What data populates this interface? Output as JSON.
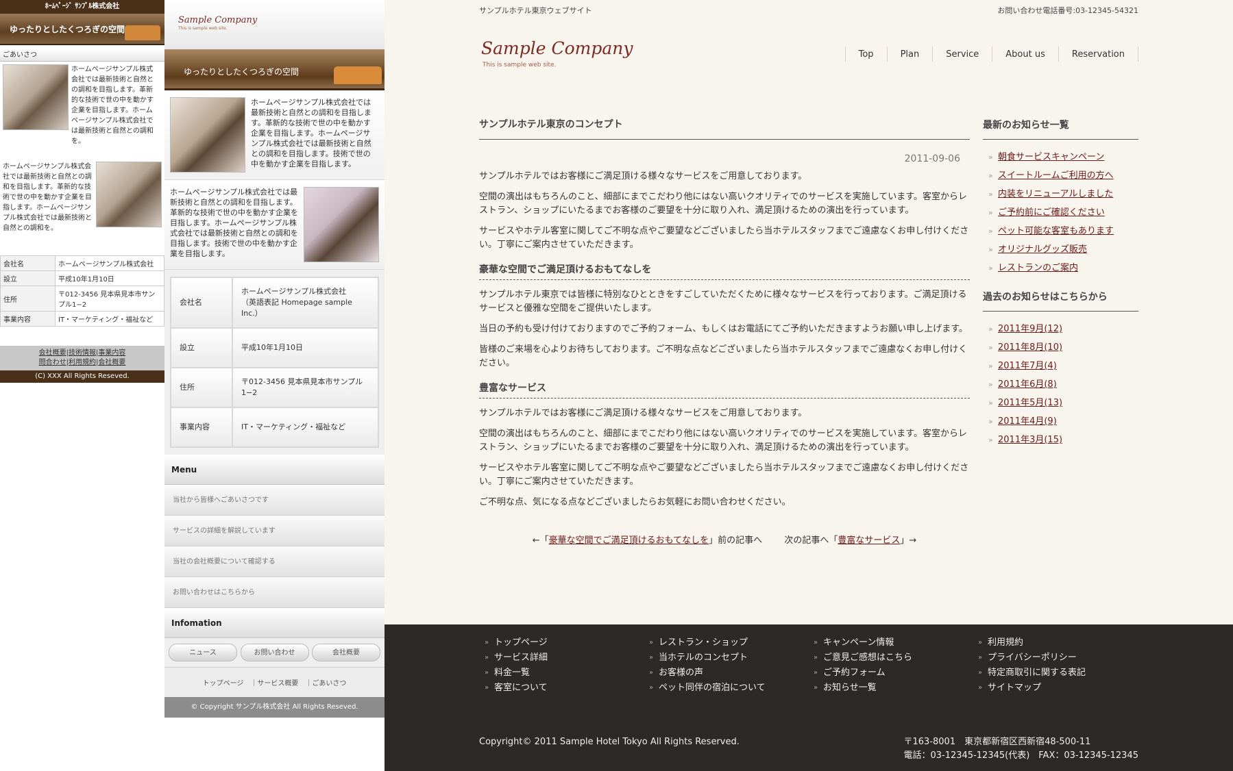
{
  "mobile": {
    "brand": "ﾎｰﾑﾍﾟｰｼﾞ ｻﾝﾌﾟﾙ株式会社",
    "hero": "ゆったりとしたくつろぎの空間",
    "section": "ごあいさつ",
    "text1": "ホームページサンプル株式会社では最新技術と自然との調和を目指します。革新的な技術で世の中を動かす企業を目指します。ホームページサンプル株式会社では最新技術と自然との調和を。",
    "text2": "ホームページサンプル株式会社では最新技術と自然との調和を目指します。革新的な技術で世の中を動かす企業を目指します。ホームページサンプル株式会社では最新技術と自然との調和を。",
    "table": [
      {
        "k": "会社名",
        "v": "ホームページサンプル株式会社"
      },
      {
        "k": "設立",
        "v": "平成10年1月10日"
      },
      {
        "k": "住所",
        "v": "〒012-3456 見本県見本市サンプル1−2"
      },
      {
        "k": "事業内容",
        "v": "IT・マーケティング・福祉など"
      }
    ],
    "links": [
      "会社概要",
      "技術情報",
      "事業内容",
      "問合わせ",
      "利用規約",
      "会社概要"
    ],
    "copyright": "(C) XXX All Rights Reseved."
  },
  "tablet": {
    "logo": "Sample Company",
    "logo_sub": "This is sample web site.",
    "hero": "ゆったりとしたくつろぎの空間",
    "text1": "ホームページサンプル株式会社では最新技術と自然との調和を目指します。革新的な技術で世の中を動かす企業を目指します。ホームページサンプル株式会社では最新技術と自然との調和を目指します。技術で世の中を動かす企業を目指します。",
    "text2": "ホームページサンプル株式会社では最新技術と自然との調和を目指します。革新的な技術で世の中を動かす企業を目指します。ホームページサンプル株式会社では最新技術と自然との調和を目指します。技術で世の中を動かす企業を目指します。",
    "table": [
      {
        "k": "会社名",
        "v": "ホームページサンプル株式会社",
        "v2": "（英語表記 Homepage sample Inc.）"
      },
      {
        "k": "設立",
        "v": "平成10年1月10日",
        "v2": ""
      },
      {
        "k": "住所",
        "v": "〒012-3456 見本県見本市サンプル1−2",
        "v2": ""
      },
      {
        "k": "事業内容",
        "v": "IT・マーケティング・福祉など",
        "v2": ""
      }
    ],
    "menu_title": "Menu",
    "menu": [
      "当社から皆様へごあいさつです",
      "サービスの詳細を解説しています",
      "当社の会社概要について確認する",
      "お問い合わせはこちらから"
    ],
    "info_title": "Infomation",
    "buttons": [
      "ニュース",
      "お問い合わせ",
      "会社概要"
    ],
    "footer_links": "トップページ　｜サービス概要　｜ごあいさつ",
    "copyright": "© Copyright サンプル株式会社 All Rights Reseved."
  },
  "desktop": {
    "site_title": "サンプルホテル東京ウェブサイト",
    "phone": "お問い合わせ電話番号:03-12345-54321",
    "logo": "Sample Company",
    "logo_sub": "This is sample web site.",
    "nav": [
      "Top",
      "Plan",
      "Service",
      "About us",
      "Reservation"
    ],
    "main": {
      "title": "サンプルホテル東京のコンセプト",
      "date": "2011-09-06",
      "p1": "サンプルホテルではお客様にご満足頂ける様々なサービスをご用意しております。",
      "p2": "空間の演出はもちろんのこと、細部にまでこだわり他にはない高いクオリティでのサービスを実施しています。客室からレストラン、ショップにいたるまでお客様のご要望を十分に取り入れ、満足頂けるための演出を行っています。",
      "p3": "サービスやホテル客室に関してご不明な点やご要望などございましたら当ホテルスタッフまでご遠慮なくお申し付けください。丁寧にご案内させていただきます。",
      "h1": "豪華な空間でご満足頂けるおもてなしを",
      "p4": "サンプルホテル東京では皆様に特別なひとときをすごしていただくために様々なサービスを行っております。ご満足頂けるサービスと優雅な空間をご提供いたします。",
      "p5": "当日の予約も受け付けておりますのでご予約フォーム、もしくはお電話にてご予約いただきますようお願い申し上げます。",
      "p6": "皆様のご来場を心よりお待ちしております。ご不明な点などございましたら当ホテルスタッフまでご遠慮なくお申し付けください。",
      "h2": "豊富なサービス",
      "p7": "サンプルホテルではお客様にご満足頂ける様々なサービスをご用意しております。",
      "p8": "空間の演出はもちろんのこと、細部にまでこだわり他にはない高いクオリティでのサービスを実施しています。客室からレストラン、ショップにいたるまでお客様のご要望を十分に取り入れ、満足頂けるための演出を行っています。",
      "p9": "サービスやホテル客室に関してご不明な点やご要望などございましたら当ホテルスタッフまでご遠慮なくお申し付けください。丁寧にご案内させていただきます。",
      "p10": "ご不明な点、気になる点などございましたらお気軽にお問い合わせください。",
      "prev_pre": "←「",
      "prev_link": "豪華な空間でご満足頂けるおもてなしを",
      "prev_post": "」前の記事へ",
      "next_pre": "次の記事へ「",
      "next_link": "豊富なサービス",
      "next_post": "」→"
    },
    "side": {
      "news_title": "最新のお知らせ一覧",
      "news": [
        "朝食サービスキャンペーン",
        "スイートルームご利用の方へ",
        "内装をリニューアルしました",
        "ご予約前にご確認ください",
        "ペット可能な客室もあります",
        "オリジナルグッズ販売",
        "レストランのご案内"
      ],
      "archive_title": "過去のお知らせはこちらから",
      "archive": [
        "2011年9月(12)",
        "2011年8月(10)",
        "2011年7月(4)",
        "2011年6月(8)",
        "2011年5月(13)",
        "2011年4月(9)",
        "2011年3月(15)"
      ]
    },
    "footer": {
      "cols": [
        [
          "トップページ",
          "サービス詳細",
          "料金一覧",
          "客室について"
        ],
        [
          "レストラン・ショップ",
          "当ホテルのコンセプト",
          "お客様の声",
          "ペット同伴の宿泊について"
        ],
        [
          "キャンペーン情報",
          "ご意見ご感想はこちら",
          "ご予約フォーム",
          "お知らせ一覧"
        ],
        [
          "利用規約",
          "プライバシーポリシー",
          "特定商取引に関する表記",
          "サイトマップ"
        ]
      ],
      "copyright": "Copyright© 2011 Sample Hotel Tokyo All Rights Reserved.",
      "address": "〒163-8001　東京都新宿区西新宿48-500-11",
      "tel": "電話：03-12345-12345(代表)　FAX：03-12345-12345"
    }
  }
}
